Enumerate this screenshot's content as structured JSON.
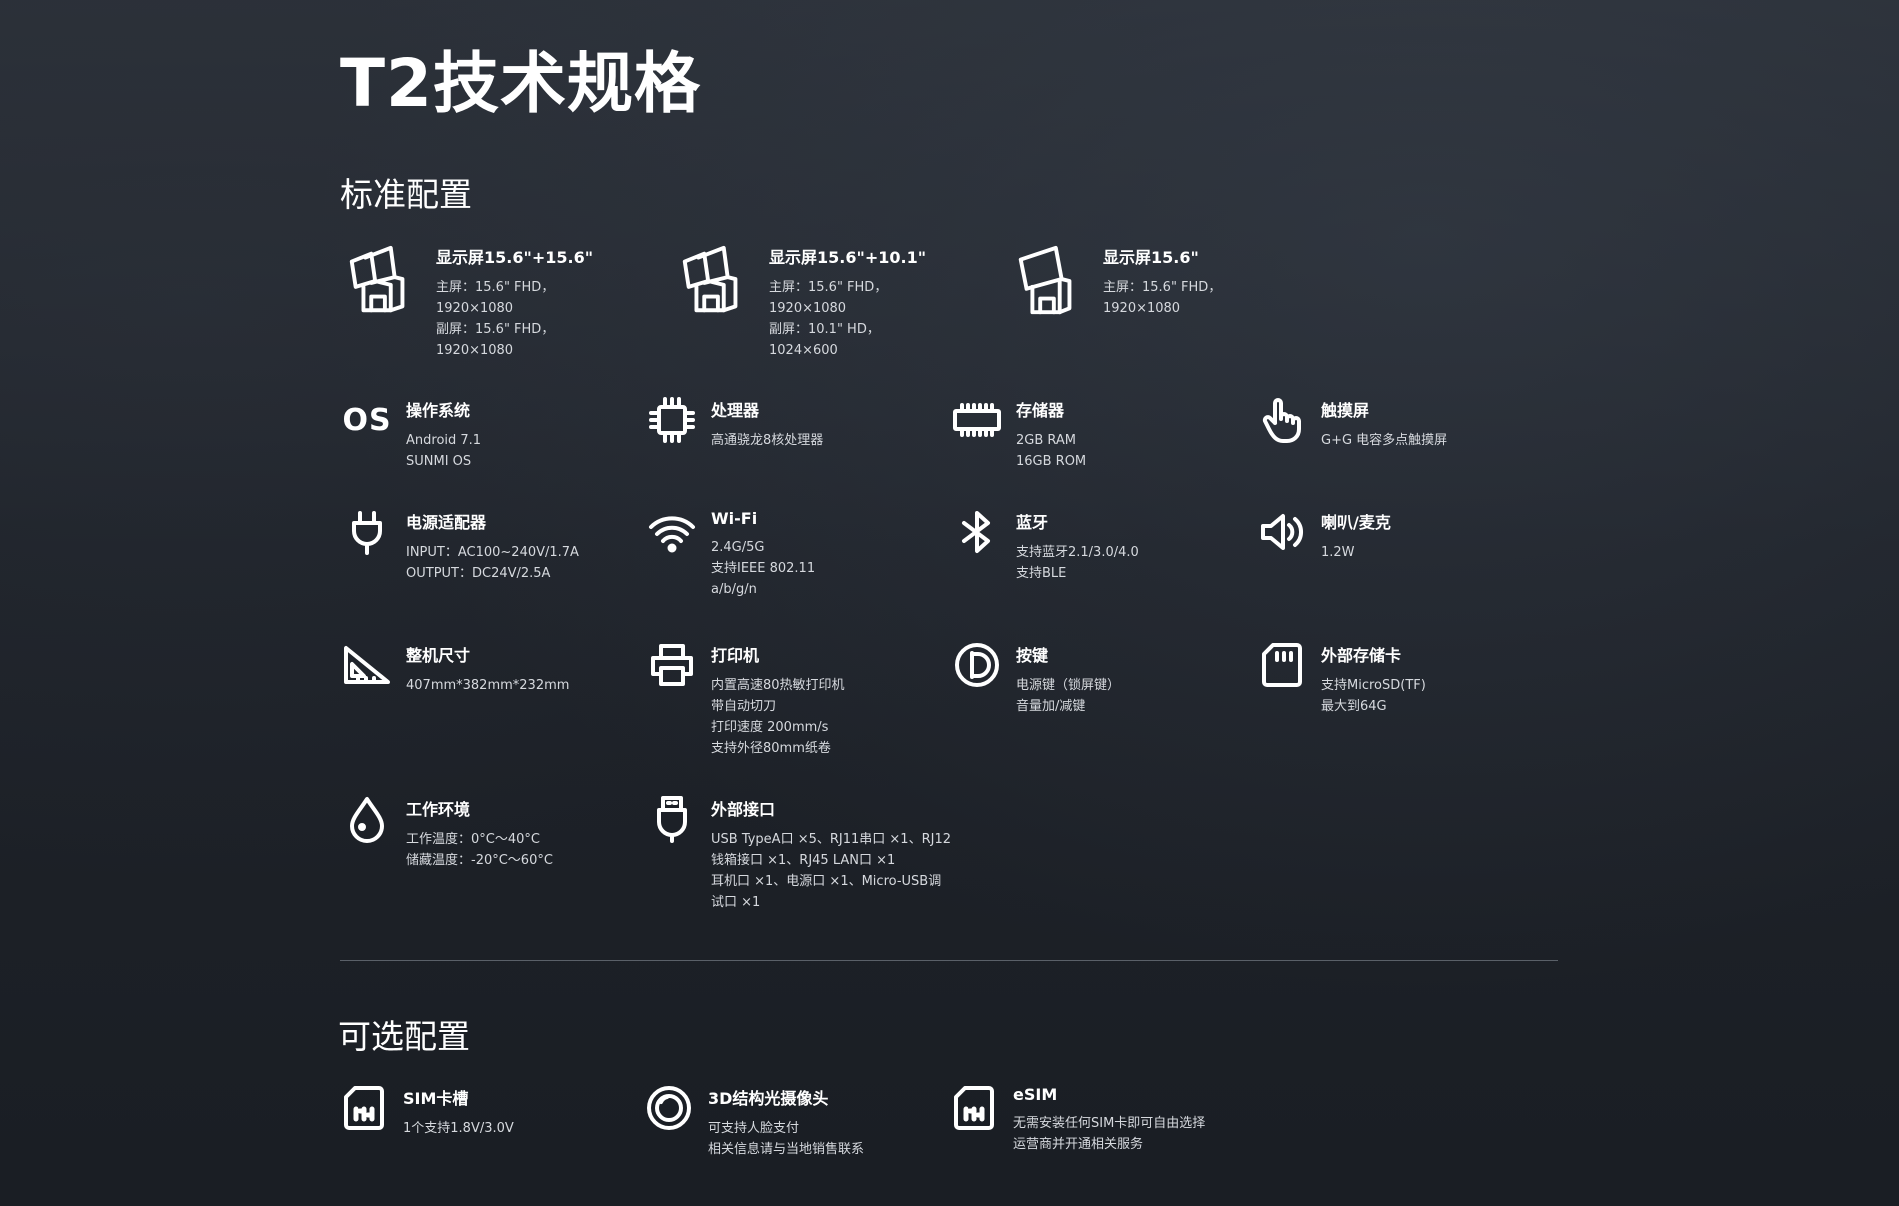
{
  "page": {
    "title": "T2技术规格"
  },
  "standard": {
    "title": "标准配置",
    "displays": [
      {
        "name": "显示屏15.6\"+15.6\"",
        "icon": "dual-screen-pos-icon",
        "lines": [
          "主屏：15.6\" FHD，",
          "1920×1080",
          "副屏：15.6\" FHD，",
          "1920×1080"
        ]
      },
      {
        "name": "显示屏15.6\"+10.1\"",
        "icon": "dual-screen-pos-icon",
        "lines": [
          "主屏：15.6\" FHD，",
          "1920×1080",
          "副屏：10.1\" HD，",
          "1024×600"
        ]
      },
      {
        "name": "显示屏15.6\"",
        "icon": "single-screen-pos-icon",
        "lines": [
          "主屏：15.6\" FHD，",
          "1920×1080"
        ]
      }
    ],
    "specs": [
      {
        "name": "操作系统",
        "icon": "os-icon",
        "icon_text": "OS",
        "lines": [
          "Android 7.1",
          "SUNMI OS"
        ]
      },
      {
        "name": "处理器",
        "icon": "processor-chip-icon",
        "lines": [
          "高通骁龙8核处理器"
        ]
      },
      {
        "name": "存储器",
        "icon": "memory-module-icon",
        "lines": [
          "2GB RAM",
          "16GB ROM"
        ]
      },
      {
        "name": "触摸屏",
        "icon": "touch-hand-icon",
        "lines": [
          "G+G 电容多点触摸屏"
        ]
      },
      {
        "name": "电源适配器",
        "icon": "power-plug-icon",
        "lines": [
          "INPUT：AC100~240V/1.7A",
          "OUTPUT：DC24V/2.5A"
        ]
      },
      {
        "name": "Wi-Fi",
        "icon": "wifi-icon",
        "lines": [
          "2.4G/5G",
          "支持IEEE 802.11",
          "a/b/g/n"
        ]
      },
      {
        "name": "蓝牙",
        "icon": "bluetooth-icon",
        "lines": [
          "支持蓝牙2.1/3.0/4.0",
          "支持BLE"
        ]
      },
      {
        "name": "喇叭/麦克",
        "icon": "speaker-icon",
        "lines": [
          "1.2W"
        ]
      },
      {
        "name": "整机尺寸",
        "icon": "ruler-triangle-icon",
        "lines": [
          "407mm*382mm*232mm"
        ]
      },
      {
        "name": "打印机",
        "icon": "printer-icon",
        "lines": [
          "内置高速80热敏打印机",
          "带自动切刀",
          "打印速度 200mm/s",
          "支持外径80mm纸卷"
        ]
      },
      {
        "name": "按键",
        "icon": "power-button-icon",
        "lines": [
          "电源键（锁屏键）",
          "音量加/减键"
        ]
      },
      {
        "name": "外部存储卡",
        "icon": "sd-card-icon",
        "lines": [
          "支持MicroSD(TF)",
          "最大到64G"
        ]
      },
      {
        "name": "工作环境",
        "icon": "water-drop-icon",
        "lines": [
          "工作温度：0°C～40°C",
          "储藏温度：-20°C～60°C"
        ]
      },
      {
        "name": "外部接口",
        "icon": "usb-port-icon",
        "lines": [
          "USB TypeA口 ×5、RJ11串口 ×1、RJ12",
          "钱箱接口 ×1、RJ45 LAN口 ×1",
          "耳机口 ×1、电源口 ×1、Micro-USB调",
          "试口 ×1"
        ]
      }
    ]
  },
  "optional": {
    "title": "可选配置",
    "specs": [
      {
        "name": "SIM卡槽",
        "icon": "sim-card-icon",
        "lines": [
          "1个支持1.8V/3.0V"
        ]
      },
      {
        "name": "3D结构光摄像头",
        "icon": "camera-lens-icon",
        "lines": [
          "可支持人脸支付",
          "相关信息请与当地销售联系"
        ]
      },
      {
        "name": "eSIM",
        "icon": "esim-icon",
        "lines": [
          "无需安装任何SIM卡即可自由选择",
          "运营商并开通相关服务"
        ]
      }
    ]
  }
}
